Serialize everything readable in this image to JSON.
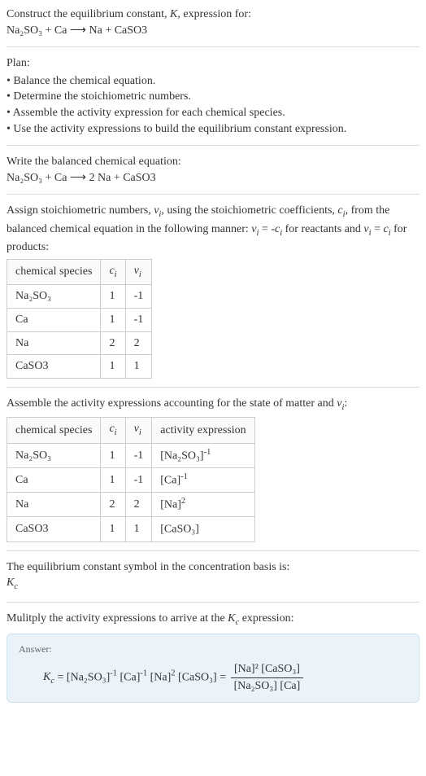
{
  "intro": {
    "line1": "Construct the equilibrium constant, K, expression for:",
    "equation": "Na₂SO₃ + Ca ⟶ Na + CaSO3"
  },
  "plan": {
    "heading": "Plan:",
    "items": [
      "Balance the chemical equation.",
      "Determine the stoichiometric numbers.",
      "Assemble the activity expression for each chemical species.",
      "Use the activity expressions to build the equilibrium constant expression."
    ]
  },
  "balanced": {
    "heading": "Write the balanced chemical equation:",
    "equation": "Na₂SO₃ + Ca ⟶ 2 Na + CaSO3"
  },
  "assign": {
    "text": "Assign stoichiometric numbers, νᵢ, using the stoichiometric coefficients, cᵢ, from the balanced chemical equation in the following manner: νᵢ = -cᵢ for reactants and νᵢ = cᵢ for products:"
  },
  "table1": {
    "headers": [
      "chemical species",
      "cᵢ",
      "νᵢ"
    ],
    "rows": [
      [
        "Na₂SO₃",
        "1",
        "-1"
      ],
      [
        "Ca",
        "1",
        "-1"
      ],
      [
        "Na",
        "2",
        "2"
      ],
      [
        "CaSO3",
        "1",
        "1"
      ]
    ]
  },
  "assemble": {
    "text": "Assemble the activity expressions accounting for the state of matter and νᵢ:"
  },
  "table2": {
    "headers": [
      "chemical species",
      "cᵢ",
      "νᵢ",
      "activity expression"
    ],
    "rows": [
      {
        "species": "Na₂SO₃",
        "c": "1",
        "v": "-1",
        "base": "[Na₂SO₃]",
        "exp": "-1"
      },
      {
        "species": "Ca",
        "c": "1",
        "v": "-1",
        "base": "[Ca]",
        "exp": "-1"
      },
      {
        "species": "Na",
        "c": "2",
        "v": "2",
        "base": "[Na]",
        "exp": "2"
      },
      {
        "species": "CaSO3",
        "c": "1",
        "v": "1",
        "base": "[CaSO₃]",
        "exp": ""
      }
    ]
  },
  "eqsymbol": {
    "text": "The equilibrium constant symbol in the concentration basis is:",
    "symbol": "K_c"
  },
  "multiply": {
    "text": "Mulitply the activity expressions to arrive at the K_c expression:"
  },
  "answer": {
    "label": "Answer:",
    "lhs": "K_c = ",
    "mid_parts": [
      {
        "base": "[Na₂SO₃]",
        "exp": "-1"
      },
      {
        "base": "[Ca]",
        "exp": "-1"
      },
      {
        "base": "[Na]",
        "exp": "2"
      },
      {
        "base": "[CaSO₃]",
        "exp": ""
      }
    ],
    "equals": " = ",
    "frac_num": "[Na]² [CaSO₃]",
    "frac_den": "[Na₂SO₃] [Ca]"
  }
}
